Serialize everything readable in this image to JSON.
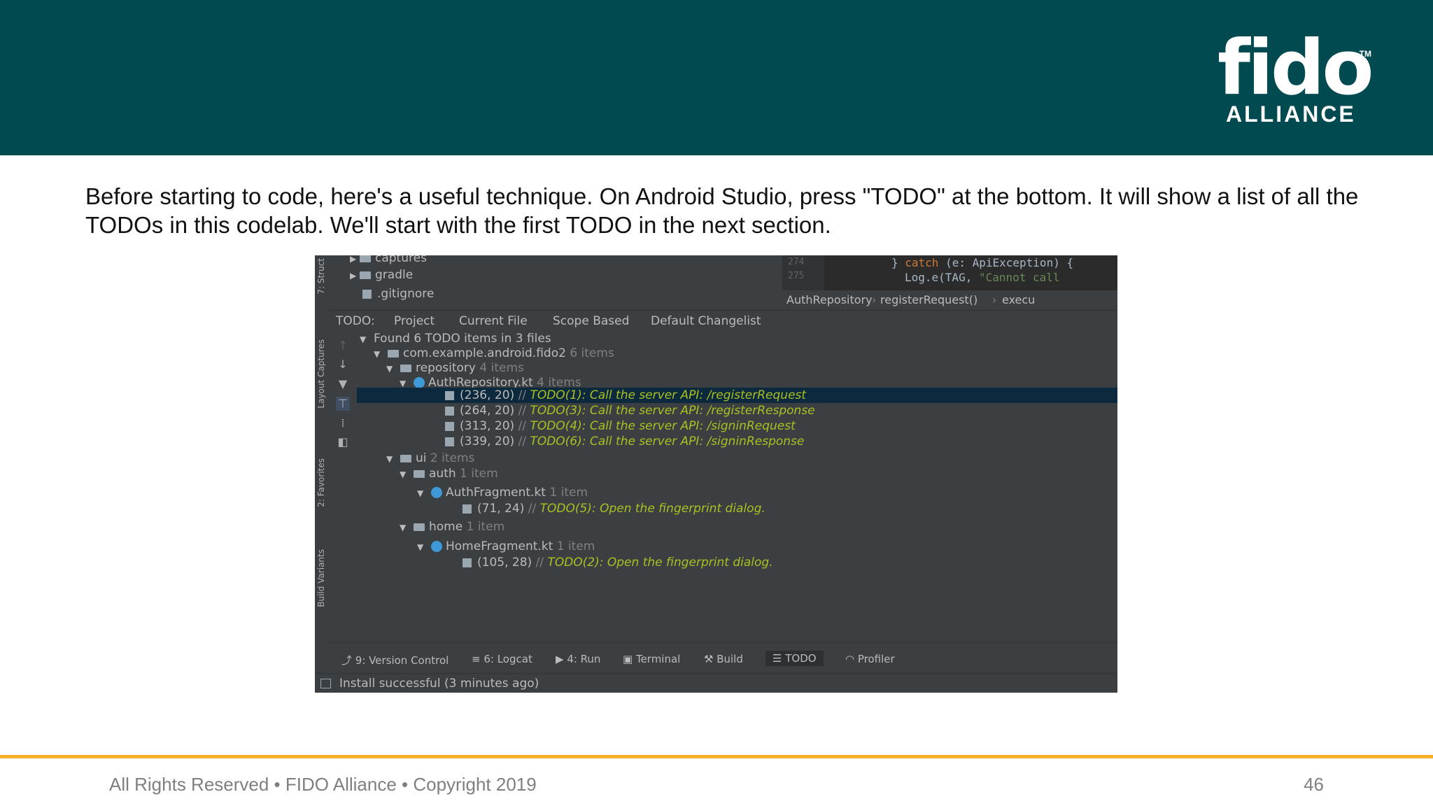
{
  "logo": {
    "text_main": "fi",
    "text_accent": "i",
    "text_end": "do",
    "tm": "TM",
    "sub": "ALLIANCE"
  },
  "intro": "Before starting to code, here's a useful technique. On Android Studio, press \"TODO\" at the bottom. It will show a list of all the TODOs in this codelab. We'll start with the first TODO in the next section.",
  "ide": {
    "side_tabs": [
      "7: Struct",
      "Layout Captures",
      "2: Favorites",
      "Build Variants"
    ],
    "project_tree": [
      "captures",
      "gradle",
      ".gitignore"
    ],
    "gutter": [
      "274",
      "275"
    ],
    "code": {
      "line1_a": "} ",
      "line1_kw": "catch",
      "line1_b": " (e: ApiException) {",
      "line2_a": "Log.e(TAG, ",
      "line2_str": "\"Cannot call"
    },
    "breadcrumbs": [
      "AuthRepository",
      "registerRequest()",
      "execu"
    ],
    "tabs": {
      "label": "TODO:",
      "items": [
        "Project",
        "Current File",
        "Scope Based",
        "Default Changelist"
      ]
    },
    "tree": {
      "summary": "Found 6 TODO items in 3 files",
      "package": {
        "name": "com.example.android.fido2",
        "count": "6 items"
      },
      "repository": {
        "name": "repository",
        "count": "4 items"
      },
      "auth_repo": {
        "name": "AuthRepository.kt",
        "count": "4 items"
      },
      "repo_items": [
        {
          "pos": "(236, 20)",
          "slash": "//",
          "text": "TODO(1): Call the server API: /registerRequest"
        },
        {
          "pos": "(264, 20)",
          "slash": "//",
          "text": "TODO(3): Call the server API: /registerResponse"
        },
        {
          "pos": "(313, 20)",
          "slash": "//",
          "text": "TODO(4): Call the server API: /signinRequest"
        },
        {
          "pos": "(339, 20)",
          "slash": "//",
          "text": "TODO(6): Call the server API: /signinResponse"
        }
      ],
      "ui": {
        "name": "ui",
        "count": "2 items"
      },
      "auth": {
        "name": "auth",
        "count": "1 item"
      },
      "auth_fragment": {
        "name": "AuthFragment.kt",
        "count": "1 item"
      },
      "auth_item": {
        "pos": "(71, 24)",
        "slash": "//",
        "text": "TODO(5): Open the fingerprint dialog."
      },
      "home": {
        "name": "home",
        "count": "1 item"
      },
      "home_fragment": {
        "name": "HomeFragment.kt",
        "count": "1 item"
      },
      "home_item": {
        "pos": "(105, 28)",
        "slash": "//",
        "text": "TODO(2): Open the fingerprint dialog."
      }
    },
    "bottom_tabs": [
      {
        "label": "9: Version Control"
      },
      {
        "label": "6: Logcat"
      },
      {
        "label": "4: Run"
      },
      {
        "label": "Terminal"
      },
      {
        "label": "Build"
      },
      {
        "label": "TODO"
      },
      {
        "label": "Profiler"
      }
    ],
    "status": "Install successful (3 minutes ago)"
  },
  "footer": {
    "left": "All Rights Reserved • FIDO Alliance • Copyright 2019",
    "page": "46"
  },
  "colors": {
    "header": "#004a50",
    "accent": "#f6b026",
    "todo": "#a8c023",
    "selected_row": "#0d293e"
  }
}
